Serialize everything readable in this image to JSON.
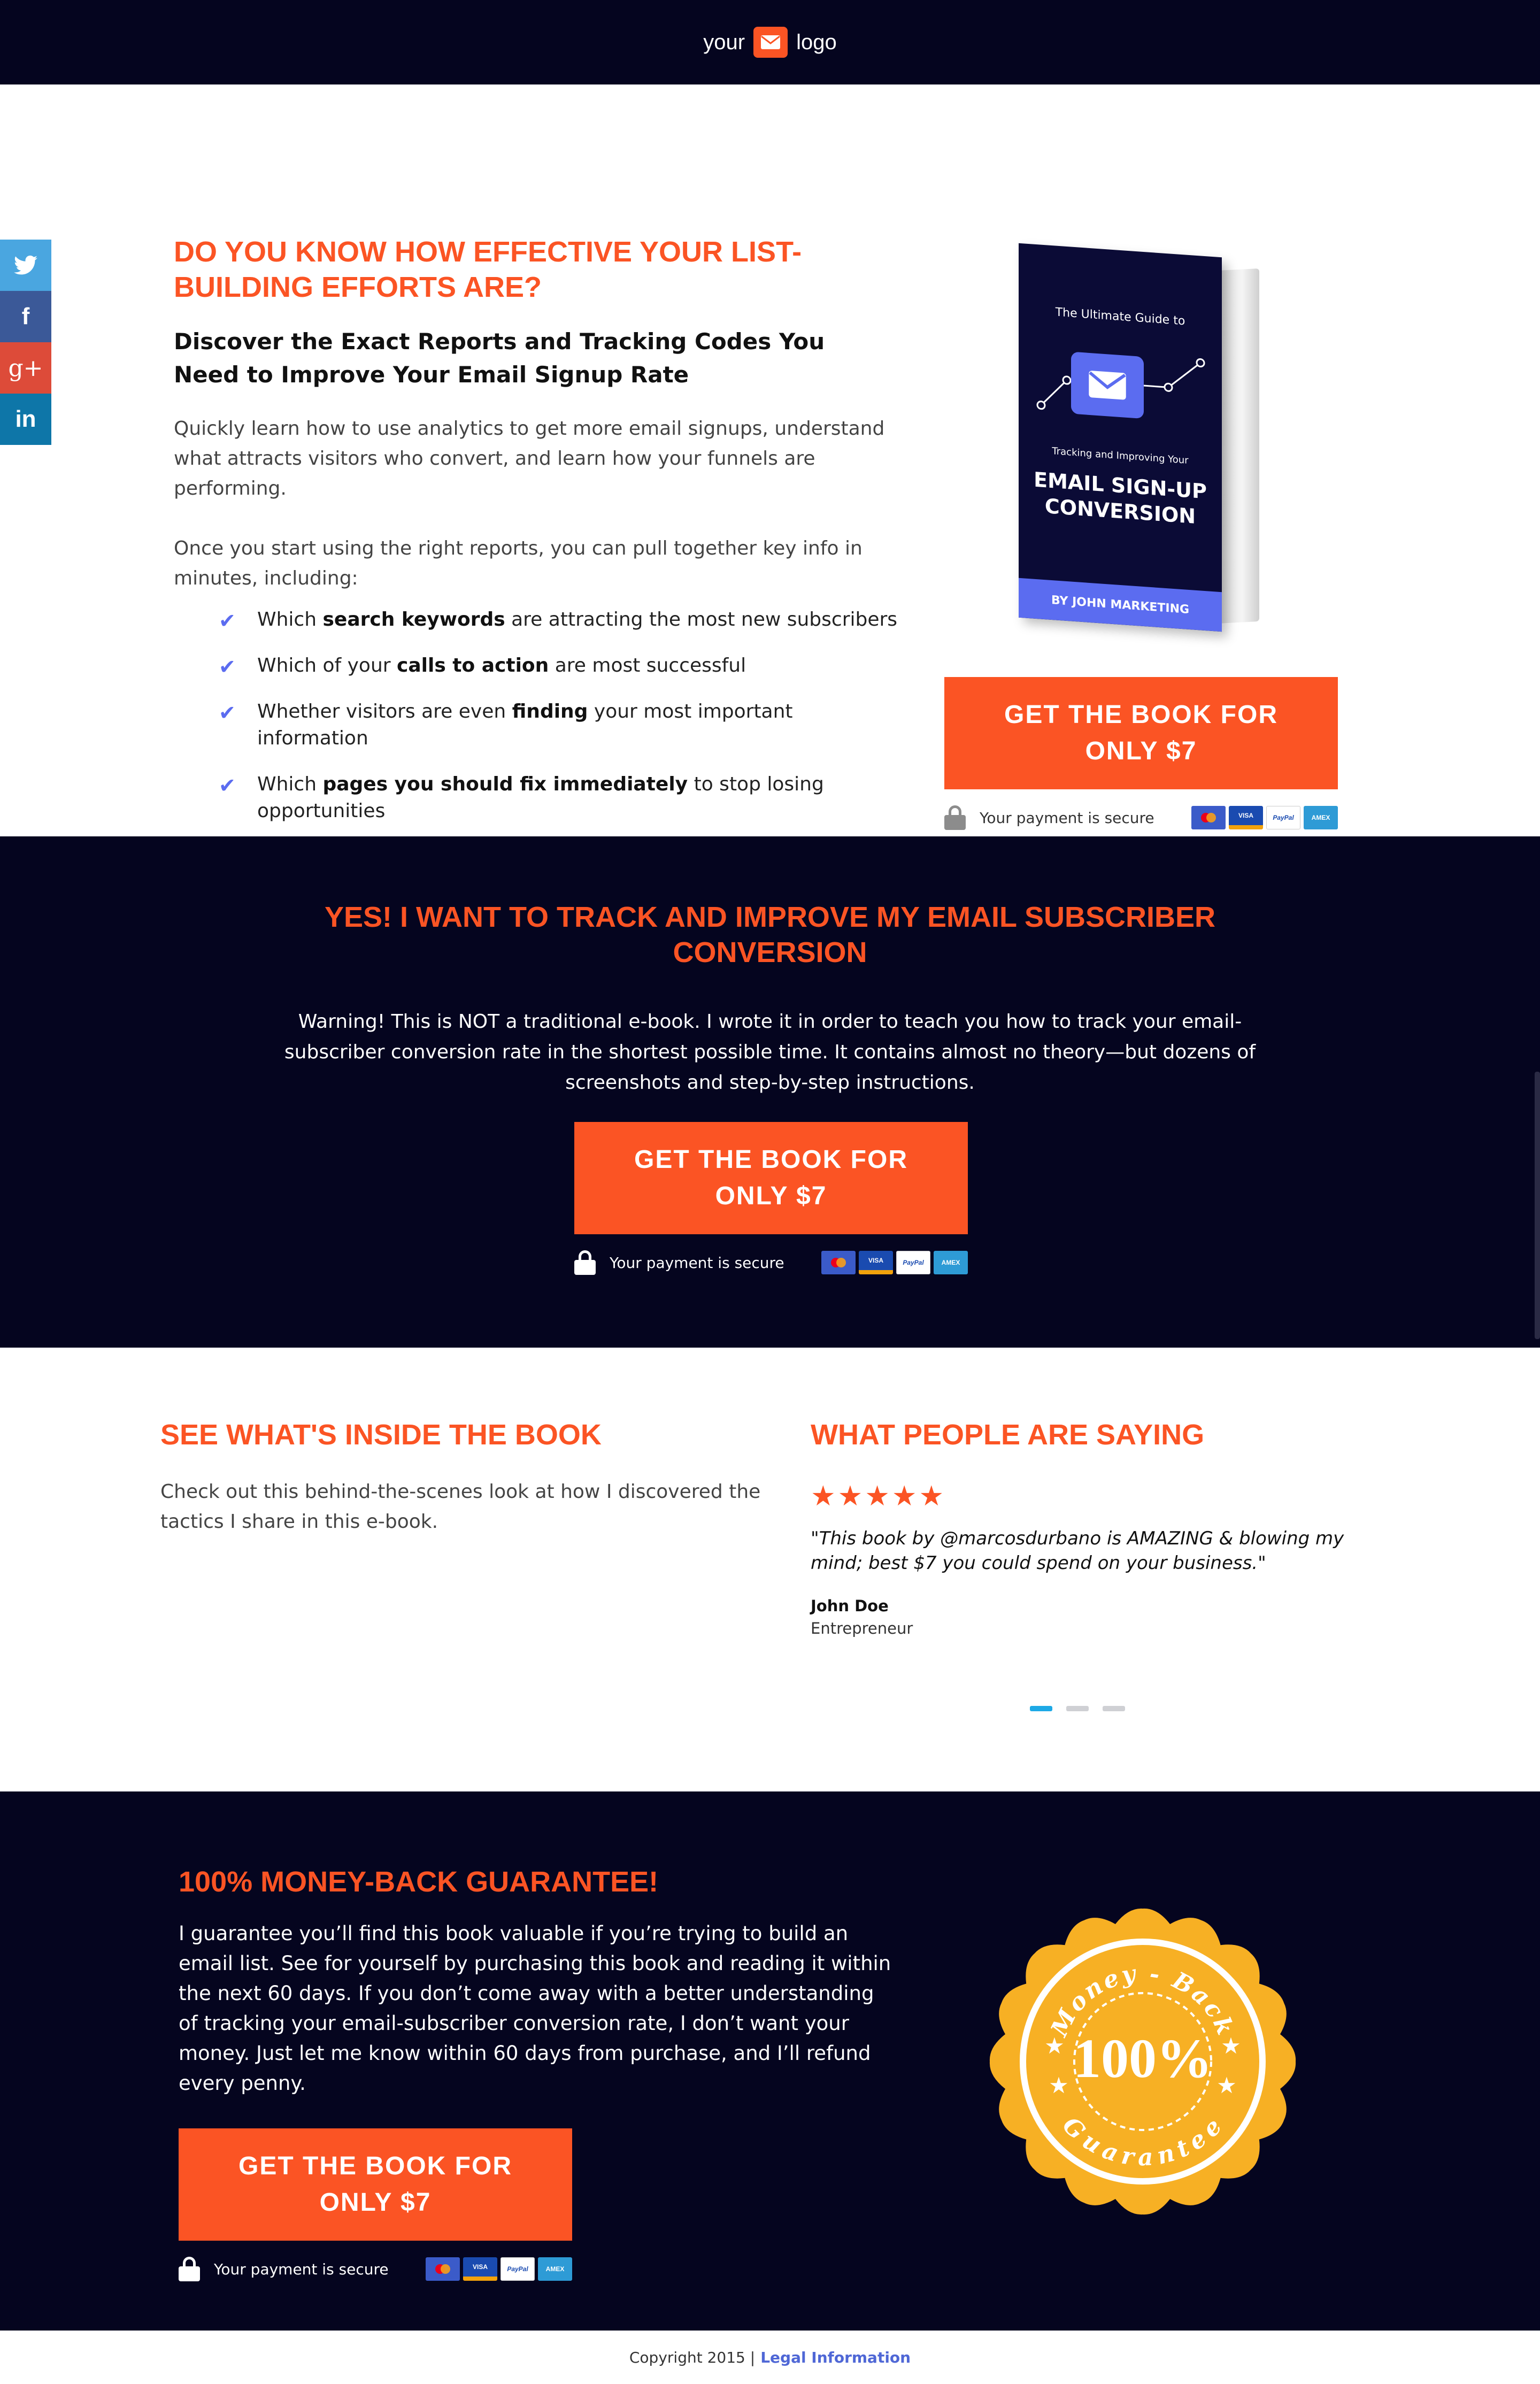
{
  "header": {
    "logo_left": "your",
    "logo_right": "logo"
  },
  "social": [
    {
      "name": "twitter",
      "glyph": "t",
      "color": "#4aa6e0"
    },
    {
      "name": "facebook",
      "glyph": "f",
      "color": "#3b5998"
    },
    {
      "name": "google-plus",
      "glyph": "g+",
      "color": "#dd4b39"
    },
    {
      "name": "linkedin",
      "glyph": "in",
      "color": "#0e76a8"
    }
  ],
  "hero": {
    "title": "DO YOU KNOW HOW EFFECTIVE YOUR LIST-BUILDING EFFORTS ARE?",
    "subtitle": "Discover the Exact Reports and Tracking Codes You Need to Improve Your Email Signup Rate",
    "para1": "Quickly learn how to use analytics to get more email signups, understand what attracts visitors who convert, and learn how your funnels are performing.",
    "para2": "Once you start using the right reports, you can pull together key info in minutes, including:",
    "bullets": [
      {
        "pre": "Which ",
        "bold": "search keywords",
        "post": " are attracting the most new subscribers"
      },
      {
        "pre": "Which of your ",
        "bold": "calls to action",
        "post": " are most successful"
      },
      {
        "pre": "Whether visitors are even ",
        "bold": "finding",
        "post": " your most important information"
      },
      {
        "pre": "Which ",
        "bold": "pages you should fix immediately",
        "post": " to stop losing opportunities"
      }
    ],
    "book": {
      "line1": "The Ultimate Guide to",
      "line2": "Tracking and Improving Your",
      "line3a": "EMAIL SIGN-UP",
      "line3b": "CONVERSION",
      "author": "BY JOHN MARKETING"
    }
  },
  "cta": {
    "line1": "GET THE BOOK FOR",
    "line2": "ONLY $7",
    "secure": "Your payment is secure"
  },
  "cards": {
    "visa": "VISA",
    "paypal": "PayPal",
    "amex": "AMEX"
  },
  "mid": {
    "title_line1": "YES! I WANT TO TRACK AND IMPROVE MY EMAIL SUBSCRIBER",
    "title_line2": "CONVERSION",
    "warning": "Warning! This is NOT a traditional e-book. I wrote it in order to teach you how to track your email-subscriber conversion rate in the shortest possible time. It contains almost no theory—but dozens of screenshots and step-by-step instructions."
  },
  "inside": {
    "title": "SEE WHAT'S INSIDE THE BOOK",
    "text": "Check out this behind-the-scenes look at how I discovered the tactics I share in this e-book."
  },
  "reviews": {
    "title": "WHAT PEOPLE ARE SAYING",
    "stars": "★★★★★",
    "quote": "\"This book by @marcosdurbano is AMAZING & blowing my mind; best $7 you could spend on your business.\"",
    "name": "John Doe",
    "role": "Entrepreneur",
    "active_slide": 1,
    "slide_count": 3
  },
  "guarantee": {
    "title": "100% MONEY-BACK GUARANTEE!",
    "text": "I guarantee you’ll find this book valuable if you’re trying to build an email list. See for yourself by purchasing this book and reading it within the next 60 days. If you don’t come away with a better understanding of tracking your email-subscriber conversion rate, I don’t want your money. Just let me know within 60 days from purchase, and I’ll refund every penny.",
    "seal_top": "Money - Back",
    "seal_center": "100%",
    "seal_bottom": "Guarantee"
  },
  "footer": {
    "copyright": "Copyright 2015 |",
    "link": "Legal Information"
  },
  "colors": {
    "navy": "#05051f",
    "orange": "#fb5424",
    "accent_blue": "#5b6cf0",
    "seal_gold": "#f7b024"
  }
}
